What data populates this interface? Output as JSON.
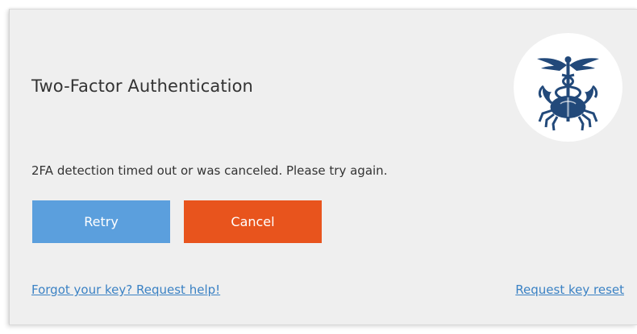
{
  "dialog": {
    "title": "Two-Factor Authentication",
    "message": "2FA detection timed out or was canceled. Please try again.",
    "logo_icon": "caduceus-crab-logo-icon"
  },
  "buttons": {
    "retry_label": "Retry",
    "cancel_label": "Cancel"
  },
  "links": {
    "help_label": "Forgot your key? Request help!",
    "reset_label": "Request key reset"
  },
  "colors": {
    "retry_button": "#5b9fdd",
    "cancel_button": "#e8541d",
    "link": "#3b82c4",
    "logo": "#22497a",
    "dialog_background": "#efefef"
  }
}
